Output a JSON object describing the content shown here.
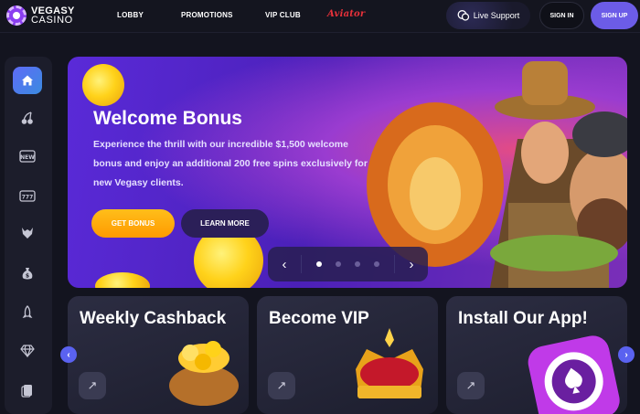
{
  "brand": {
    "line1": "VEGASY",
    "line2": "CASINO"
  },
  "nav": {
    "lobby": "LOBBY",
    "promotions": "PROMOTIONS",
    "vip_club": "VIP CLUB",
    "aviator": "Aviator"
  },
  "header": {
    "live_support": "Live Support",
    "sign_in": "SIGN IN",
    "sign_up": "SIGN UP"
  },
  "sidebar": {
    "items": [
      {
        "icon": "home-icon",
        "active": true
      },
      {
        "icon": "cherries-icon"
      },
      {
        "icon": "new-games-icon"
      },
      {
        "icon": "slot-machine-icon"
      },
      {
        "icon": "wolf-icon"
      },
      {
        "icon": "money-bag-icon"
      },
      {
        "icon": "rocket-icon"
      },
      {
        "icon": "diamond-icon"
      },
      {
        "icon": "cards-icon"
      }
    ]
  },
  "banner": {
    "title": "Welcome Bonus",
    "text": "Experience the thrill with our incredible $1,500 welcome bonus and enjoy an additional 200 free spins exclusively for new Vegasy clients.",
    "get_bonus": "GET BONUS",
    "learn_more": "LEARN MORE",
    "slides": 4,
    "active_slide": 1
  },
  "promos": [
    {
      "title": "Weekly Cashback"
    },
    {
      "title": "Become VIP"
    },
    {
      "title": "Install Our App!"
    }
  ],
  "colors": {
    "accent": "#6c5ce7",
    "gold": "#ffa800",
    "background": "#13141f"
  }
}
